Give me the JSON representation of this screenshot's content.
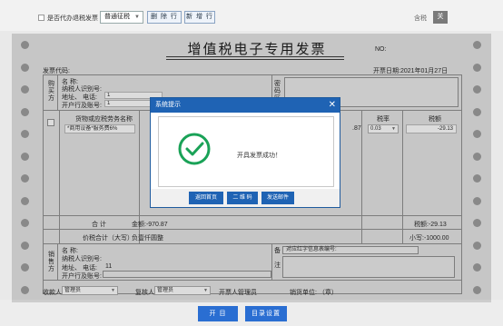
{
  "toolbar": {
    "agent_checkbox_label": "是否代办退税发票",
    "invoice_type_select": "普通征税",
    "delete_row_button": "删 除 行",
    "add_row_button": "新 增 行",
    "tax_included_label": "含税",
    "close_label": "关"
  },
  "invoice": {
    "title": "增值税电子专用发票",
    "no_label": "NO:",
    "code_label": "发票代码:",
    "date_text": "开票日期:2021年01月27日",
    "buyer_side_label": "购\n买\n方",
    "buyer": {
      "name_label": "名    称:",
      "taxpayer_id_label": "纳税人识别号:",
      "address_label": "地址、 电话:",
      "address_value": "1",
      "bank_label": "开户行及账号:",
      "bank_value": "1"
    },
    "password_area_label": "密\n码\n区",
    "goods_header": "货物或应税劳务名称",
    "goods_item": "*商用设备*服务费6%",
    "tax_rate_header": "税率",
    "tax_amount_header": "税额",
    "tax_rate_value": "0.03",
    "partial_amount": ".87",
    "tax_amount_value": "-29.13",
    "total_label": "合    计",
    "total_amount": "金额:-970.87",
    "total_tax": "税额:-29.13",
    "sum_label": "价税合计（大写）",
    "sum_uppercase": "负壹仟圆整",
    "sum_lowercase": "小写:-1000.00",
    "seller_side_label": "销\n售\n方",
    "seller": {
      "name_label": "名    称:",
      "taxpayer_id_label": "纳税人识别号:",
      "address_label": "地址、 电话:",
      "address_value": "11",
      "bank_label": "开户行及账号:"
    },
    "remarks_label": "备\n\n注",
    "red_notice": "对应红字信息表编号:",
    "payee_label": "收款人:",
    "payee_value": "管理员",
    "reviewer_label": "复核人:",
    "reviewer_value": "管理员",
    "issuer_label": "开票人:",
    "issuer_value": "管理员",
    "seller_stamp": "销货单位: （章）"
  },
  "actions": {
    "issue_button": "开  目",
    "catalog_button": "目录设置"
  },
  "dialog": {
    "title": "系统提示",
    "message": "开具发票成功！",
    "back_home": "返回首页",
    "qrcode": "二 维 码",
    "send_email": "发送邮件",
    "close_icon_char": "✕"
  },
  "colors": {
    "accent": "#1f63b4",
    "success": "#1aa257",
    "button_blue": "#2a6ed2"
  }
}
